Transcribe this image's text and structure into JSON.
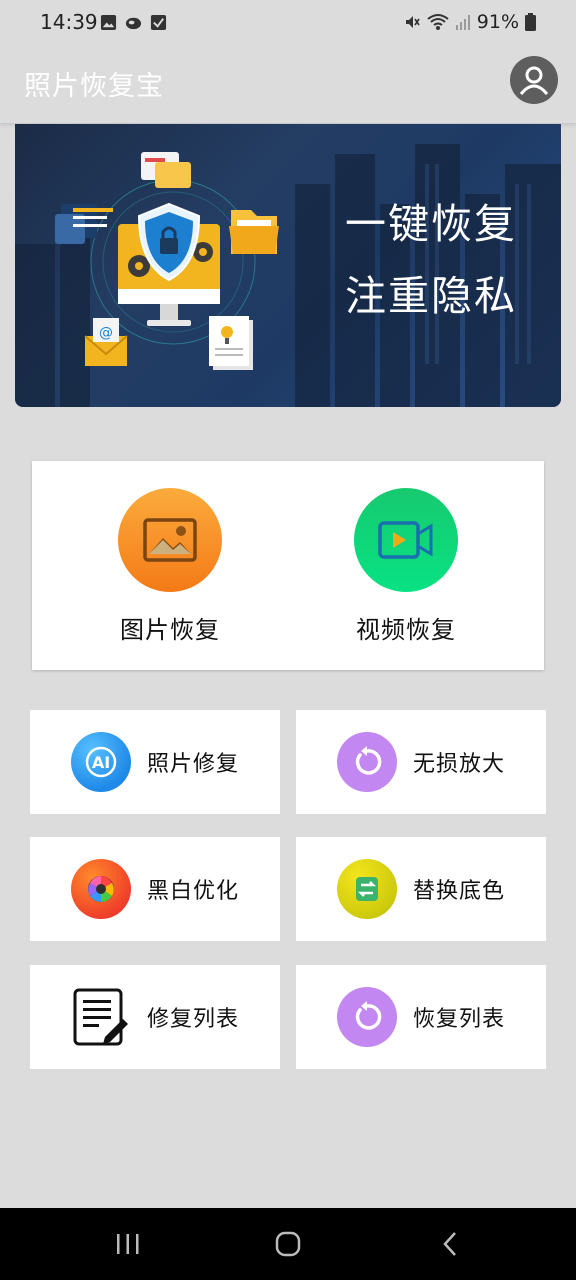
{
  "status": {
    "time": "14:39",
    "battery": "91%"
  },
  "app": {
    "title": "照片恢复宝"
  },
  "banner": {
    "line1": "一键恢复",
    "line2": "注重隐私"
  },
  "primary_actions": [
    {
      "label": "图片恢复",
      "icon": "image-icon",
      "color": "#f7931e"
    },
    {
      "label": "视频恢复",
      "icon": "video-icon",
      "color": "#10d378"
    }
  ],
  "tools": [
    {
      "label": "照片修复",
      "icon": "ai-icon"
    },
    {
      "label": "无损放大",
      "icon": "refresh-icon"
    },
    {
      "label": "黑白优化",
      "icon": "color-wheel-icon"
    },
    {
      "label": "替换底色",
      "icon": "swap-icon"
    },
    {
      "label": "修复列表",
      "icon": "list-edit-icon"
    },
    {
      "label": "恢复列表",
      "icon": "refresh-icon"
    }
  ],
  "nav": {
    "recents_icon": "recents-icon",
    "home_icon": "home-icon",
    "back_icon": "back-icon"
  }
}
